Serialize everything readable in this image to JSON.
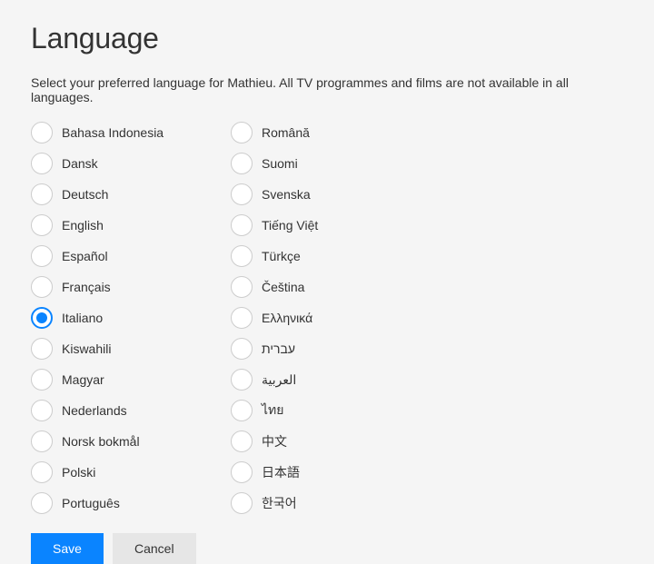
{
  "title": "Language",
  "description": "Select your preferred language for Mathieu. All TV programmes and films are not available in all languages.",
  "selected_index": 6,
  "columns": [
    [
      "Bahasa Indonesia",
      "Dansk",
      "Deutsch",
      "English",
      "Español",
      "Français",
      "Italiano",
      "Kiswahili",
      "Magyar",
      "Nederlands",
      "Norsk bokmål",
      "Polski",
      "Português"
    ],
    [
      "Română",
      "Suomi",
      "Svenska",
      "Tiếng Việt",
      "Türkçe",
      "Čeština",
      "Ελληνικά",
      "עברית",
      "العربية",
      "ไทย",
      "中文",
      "日本語",
      "한국어"
    ]
  ],
  "buttons": {
    "save": "Save",
    "cancel": "Cancel"
  }
}
